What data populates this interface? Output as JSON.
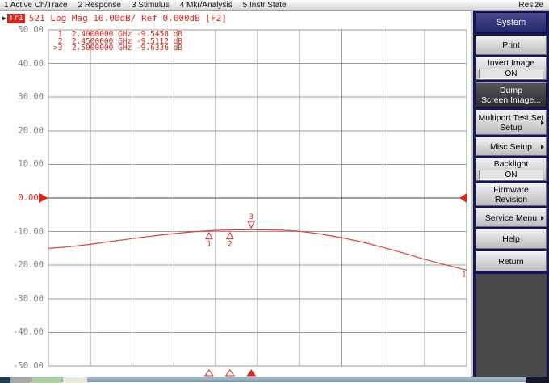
{
  "menu_bar": {
    "items": [
      "1 Active Ch/Trace",
      "2 Response",
      "3 Stimulus",
      "4 Mkr/Analysis",
      "5 Instr State"
    ],
    "resize_label": "Resize"
  },
  "trace_status": {
    "active_arrow": "▶",
    "badge": "Tr1",
    "text": "S21 Log Mag 10.00dB/ Ref 0.000dB [F2]"
  },
  "marker_table": {
    "rows": [
      " 1  2.4000000 GHz -9.5458 dB",
      " 2  2.4500000 GHz -9.5112 dB",
      ">3  2.5000000 GHz -9.6336 dB"
    ]
  },
  "plot": {
    "y_axis_labels": [
      "50.00",
      "40.00",
      "30.00",
      "20.00",
      "10.00",
      "0.000",
      "-10.00",
      "-20.00",
      "-30.00",
      "-40.00",
      "-50.00"
    ],
    "reference_index": 5,
    "grid": {
      "cols": 10,
      "rows": 10
    },
    "colors": {
      "trace": "#e23c36",
      "grid": "#9b9b9b",
      "reference_line": "#3f3f3f",
      "axis_text": "#85857d",
      "red": "#d8271d"
    },
    "trace_end_label": "1"
  },
  "chart_data": {
    "type": "line",
    "title": "Tr1 S21 Log Mag 10.00dB/ Ref 0.000dB [F2]",
    "ylabel": "dB",
    "ylim": [
      -50,
      50
    ],
    "y_tick_step": 10,
    "grid": true,
    "legend": "none",
    "trace": {
      "name": "1",
      "points_frac_db": [
        [
          0.0,
          -15.0
        ],
        [
          0.05,
          -14.5
        ],
        [
          0.1,
          -13.8
        ],
        [
          0.15,
          -12.9
        ],
        [
          0.2,
          -12.1
        ],
        [
          0.25,
          -11.3
        ],
        [
          0.3,
          -10.6
        ],
        [
          0.35,
          -10.0
        ],
        [
          0.4,
          -9.65
        ],
        [
          0.44,
          -9.5
        ],
        [
          0.48,
          -9.45
        ],
        [
          0.52,
          -9.5
        ],
        [
          0.56,
          -9.6
        ],
        [
          0.6,
          -9.9
        ],
        [
          0.65,
          -10.7
        ],
        [
          0.7,
          -11.8
        ],
        [
          0.75,
          -13.1
        ],
        [
          0.8,
          -14.7
        ],
        [
          0.85,
          -16.4
        ],
        [
          0.9,
          -18.3
        ],
        [
          0.95,
          -19.9
        ],
        [
          1.0,
          -21.5
        ]
      ]
    },
    "markers": [
      {
        "label": "1",
        "frequency": "2.4000000 GHz",
        "value_db": -9.5458,
        "frac": 0.384,
        "placement": "below",
        "active": false
      },
      {
        "label": "2",
        "frequency": "2.4500000 GHz",
        "value_db": -9.5112,
        "frac": 0.434,
        "placement": "below",
        "active": false
      },
      {
        "label": "3",
        "frequency": "2.5000000 GHz",
        "value_db": -9.6336,
        "frac": 0.485,
        "placement": "above",
        "active": true
      }
    ]
  },
  "sidebar": {
    "header": "System",
    "buttons": [
      {
        "label": "Print",
        "type": "plain",
        "height": 24
      },
      {
        "label": "Invert Image",
        "value": "ON",
        "type": "toggle",
        "height": 28
      },
      {
        "label": "Dump|Screen Image...",
        "type": "active",
        "height": 31
      },
      {
        "label": "Multiport Test Set|Setup",
        "type": "submenu",
        "height": 31
      },
      {
        "label": "Misc Setup",
        "type": "submenu",
        "height": 23
      },
      {
        "label": "Backlight",
        "value": "ON",
        "type": "toggle",
        "height": 28
      },
      {
        "label": "Firmware|Revision",
        "type": "plain",
        "height": 28
      },
      {
        "label": "Service Menu",
        "type": "submenu",
        "height": 23
      },
      {
        "label": "Help",
        "type": "plain",
        "height": 24
      },
      {
        "label": "Return",
        "type": "plain",
        "height": 25
      }
    ]
  }
}
